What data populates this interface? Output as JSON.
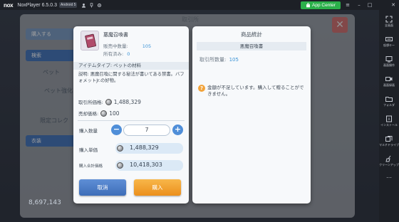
{
  "titlebar": {
    "logo": "nox",
    "app_name": "NoxPlayer 6.5.0.3",
    "android_tag": "Android 5",
    "app_center": "App Center"
  },
  "sidebar": {
    "items": [
      {
        "label": "全画面",
        "icon": "fullscreen-icon"
      },
      {
        "label": "仮想キー",
        "icon": "keyboard-icon"
      },
      {
        "label": "画面操作",
        "icon": "screen-icon"
      },
      {
        "label": "画面録画",
        "icon": "record-icon"
      },
      {
        "label": "フォルダ",
        "icon": "folder-icon"
      },
      {
        "label": "インストール",
        "icon": "apk-icon"
      },
      {
        "label": "マルチドライブ",
        "icon": "multi-icon"
      },
      {
        "label": "クリーンアップ",
        "icon": "broom-icon"
      },
      {
        "label": "…",
        "icon": "more-icon"
      }
    ]
  },
  "background": {
    "title": "取引所",
    "tabs": [
      "購入する",
      "検索",
      "ペット",
      "ペット強化",
      "限定コレク",
      "衣装"
    ],
    "bottom_value": "8,697,143"
  },
  "purchase_dialog": {
    "item_name": "悪魔召喚書",
    "on_sale_label": "販売中数量:",
    "on_sale_value": "105",
    "owned_label": "所有済み:",
    "owned_value": "0",
    "item_type": "アイテムタイプ: ペットの材料",
    "description": "説明: 悪魔召喚に関する秘法が書いてある禁書。バフォメットJr.の好物。",
    "market_price_label": "取引所価格:",
    "market_price_value": "1,488,329",
    "sell_price_label": "売却価格:",
    "sell_price_value": "100",
    "quantity_label": "購入数量",
    "quantity_value": "7",
    "unit_price_label": "購入単価",
    "unit_price_value": "1,488,329",
    "total_price_label": "購入合計価格",
    "total_price_value": "10,418,303",
    "cancel_label": "取消",
    "buy_label": "購入"
  },
  "stats_dialog": {
    "title": "商品統計",
    "item_name": "悪魔召喚書",
    "count_label": "取引所数量:",
    "count_value": "105",
    "warning": "金額が不足しています。購入して贈ることができません。"
  },
  "colors": {
    "accent_blue": "#3b93d6",
    "cancel_blue": "#3d6db8",
    "buy_orange": "#eb8f1c",
    "app_center_green": "#2bb04a"
  }
}
